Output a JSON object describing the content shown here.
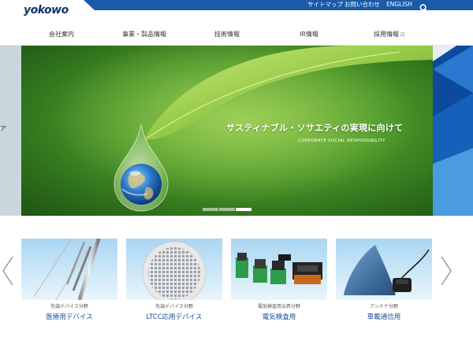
{
  "header": {
    "logo_text": "yokowo",
    "utility_links": [
      "サイトマップ",
      "お問い合わせ",
      "ENGLISH"
    ],
    "brand_color": "#1a5aa8"
  },
  "gnav": {
    "items": [
      {
        "label": "会社案内"
      },
      {
        "label": "事業・製品情報"
      },
      {
        "label": "技術情報"
      },
      {
        "label": "IR情報"
      },
      {
        "label": "採用情報",
        "ext_icon": "⊡"
      }
    ]
  },
  "hero": {
    "title": "サスティナブル・ソサエティの実現に向けて",
    "subtitle": "CORPORATE SOCIAL RESPONSIBILITY",
    "left_peek_text": "ア",
    "slide_count": 3,
    "active_slide": 3
  },
  "products": [
    {
      "category": "先端デバイス分野",
      "name": "医療用デバイス",
      "icon": "wire-tubes-image"
    },
    {
      "category": "先端デバイス分野",
      "name": "LTCC応用デバイス",
      "icon": "wafer-image"
    },
    {
      "category": "電気検査用治具分野",
      "name": "電気検査用",
      "icon": "connector-image"
    },
    {
      "category": "アンテナ分野",
      "name": "車載通信用",
      "icon": "shark-fin-antenna-image"
    }
  ]
}
